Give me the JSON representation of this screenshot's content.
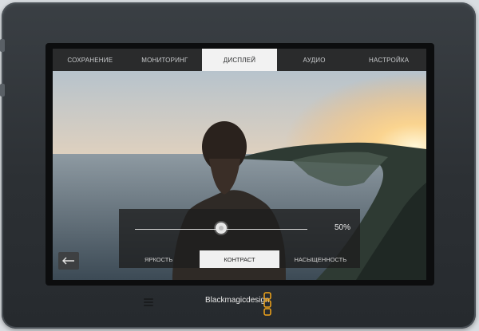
{
  "tabs": [
    {
      "label": "СОХРАНЕНИЕ",
      "active": false
    },
    {
      "label": "МОНИТОРИНГ",
      "active": false
    },
    {
      "label": "ДИСПЛЕЙ",
      "active": true
    },
    {
      "label": "АУДИО",
      "active": false
    },
    {
      "label": "НАСТРОЙКА",
      "active": false
    }
  ],
  "slider": {
    "value": "50%",
    "level_fraction": 0.5
  },
  "subtabs": [
    {
      "label": "ЯРКОСТЬ",
      "active": false
    },
    {
      "label": "КОНТРАСТ",
      "active": true
    },
    {
      "label": "НАСЫЩЕННОСТЬ",
      "active": false
    }
  ],
  "brand": {
    "text": "Blackmagicdesign"
  },
  "colors": {
    "tab_active_bg": "#f2f2f2",
    "tab_bar_bg": "#2a2b2c",
    "logo_orange": "#f2a51a"
  },
  "icons": {
    "back": "back-arrow-icon",
    "speaker": "speaker-grille-icon",
    "logo": "blackmagic-logo-icon"
  }
}
